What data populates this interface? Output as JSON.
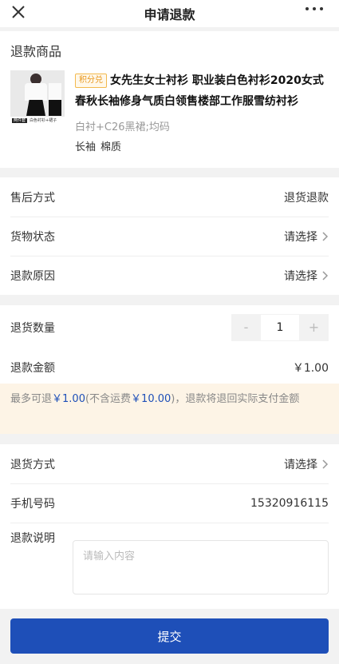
{
  "nav": {
    "title": "申请退款"
  },
  "product": {
    "section_title": "退款商品",
    "badge": "积分兑",
    "name": "女先生女士衬衫 职业装白色衬衫2020女式春秋长袖修身气质白领售楼部工作服雪纺衬衫",
    "spec": "白衬+C26黑裙;均码",
    "attrs": [
      "长袖",
      "棉质"
    ],
    "thumb_caption_tag": "两件套",
    "thumb_caption": "白色衬衫+裙子"
  },
  "service": {
    "rows": [
      {
        "label": "售后方式",
        "value": "退货退款",
        "has_arrow": false
      },
      {
        "label": "货物状态",
        "value": "请选择",
        "has_arrow": true
      },
      {
        "label": "退款原因",
        "value": "请选择",
        "has_arrow": true
      }
    ]
  },
  "quantity": {
    "label": "退货数量",
    "minus": "-",
    "value": "1",
    "plus": "+"
  },
  "amount": {
    "label": "退款金额",
    "value": "￥1.00"
  },
  "notice": {
    "prefix": "最多可退",
    "max_amount": "￥1.00",
    "middle": "(不含运费",
    "freight": "￥10.00",
    "suffix": ")，退款将退回实际支付金额"
  },
  "return": {
    "method_label": "退货方式",
    "method_value": "请选择",
    "phone_label": "手机号码",
    "phone_value": "15320916115",
    "desc_label": "退款说明",
    "desc_placeholder": "请输入内容"
  },
  "submit_label": "提交",
  "colors": {
    "accent": "#1e4fb8",
    "notice_bg": "#fdf4e6",
    "badge": "#e8961b"
  }
}
